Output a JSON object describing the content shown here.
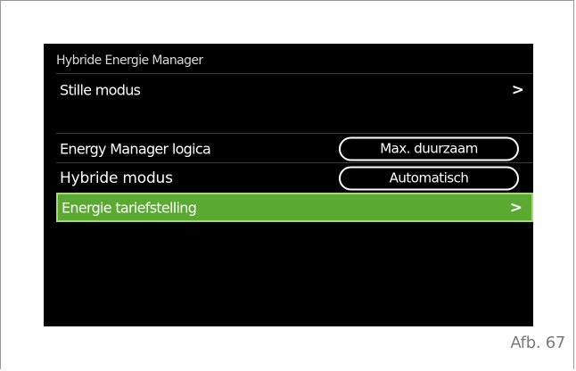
{
  "screen": {
    "title": "Hybride Energie Manager",
    "menu": [
      {
        "label": "Stille modus",
        "type": "arrow",
        "arrow": ">"
      },
      {
        "label": "Energy Manager logica",
        "type": "pill",
        "value": "Max. duurzaam"
      },
      {
        "label": "Hybride modus",
        "type": "pill",
        "value": "Automatisch"
      },
      {
        "label": "Energie tariefstelling",
        "type": "arrow",
        "arrow": ">",
        "selected": true
      }
    ]
  },
  "caption": "Afb. 67",
  "colors": {
    "screen_bg": "#000000",
    "selected_bg": "#5aaa32",
    "selected_border": "#a4d87a",
    "text": "#ffffff"
  }
}
